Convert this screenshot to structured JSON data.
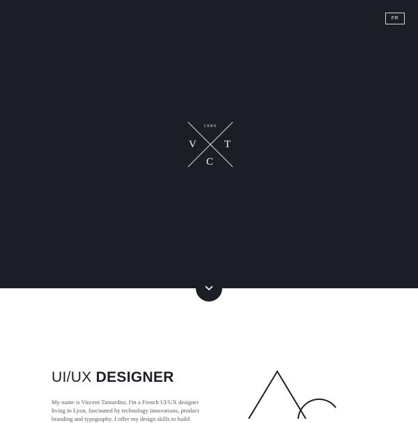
{
  "header": {
    "lang_button": "FR"
  },
  "logo": {
    "year": "1986",
    "letter_left": "V",
    "letter_right": "T",
    "letter_bottom": "C"
  },
  "scroll_down": {
    "icon": "chevron-down-icon"
  },
  "about": {
    "title_light": "UI/UX",
    "title_bold": "DESIGNER",
    "bio": "My name is Vincent Tantardini, I'm a French UI/UX designer living in Lyon, fascinated by technology innovations, product branding and typography. I offer my design skills to build"
  },
  "colors": {
    "hero_background": "#1c1e26",
    "page_background": "#ffffff",
    "text_dark": "#1c1e26"
  }
}
